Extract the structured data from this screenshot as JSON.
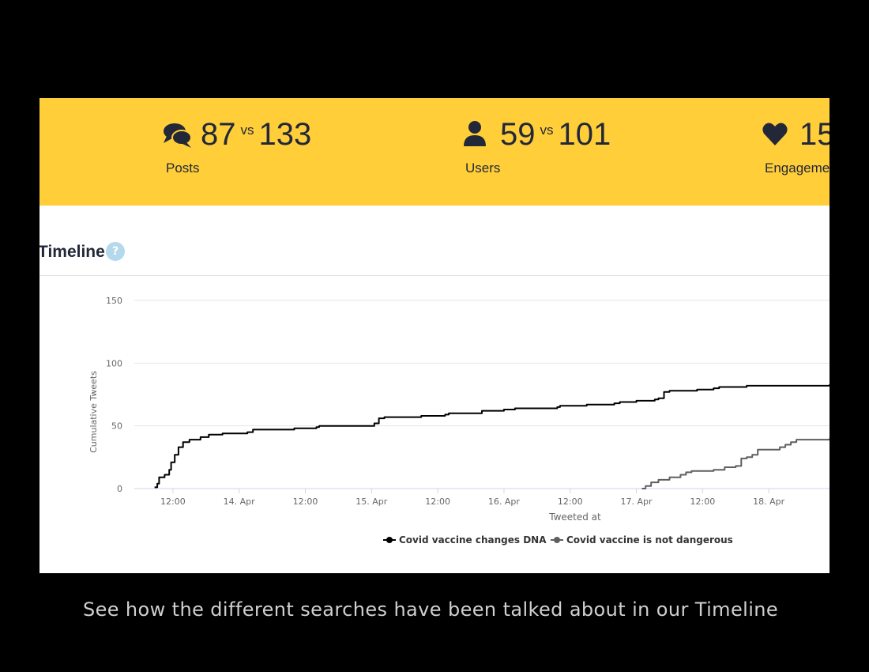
{
  "stats": [
    {
      "icon": "comments-icon",
      "value_a": "87",
      "vs": "vs",
      "value_b": "133",
      "label": "Posts"
    },
    {
      "icon": "user-icon",
      "value_a": "59",
      "vs": "vs",
      "value_b": "101",
      "label": "Users"
    },
    {
      "icon": "heart-icon",
      "value_a": "15",
      "label": "Engagement"
    }
  ],
  "timeline": {
    "title": "Timeline",
    "help": "?"
  },
  "caption": "See how the different searches have been talked about in our Timeline",
  "colors": {
    "stats_bar": "#ffce38",
    "series_a": "#000000",
    "series_b": "#5f5f5f",
    "help_icon": "#b5d9ec"
  },
  "chart_data": {
    "type": "line",
    "title": "",
    "xlabel": "Tweeted at",
    "ylabel": "Cumulative Tweets",
    "ylim": [
      0,
      150
    ],
    "yticks": [
      0,
      50,
      100,
      150
    ],
    "xlim": [
      "2021-04-13T05:00",
      "2021-04-18T11:00"
    ],
    "xticks": [
      {
        "t": "2021-04-13T12:00",
        "label": "12:00"
      },
      {
        "t": "2021-04-14T00:00",
        "label": "14. Apr"
      },
      {
        "t": "2021-04-14T12:00",
        "label": "12:00"
      },
      {
        "t": "2021-04-15T00:00",
        "label": "15. Apr"
      },
      {
        "t": "2021-04-15T12:00",
        "label": "12:00"
      },
      {
        "t": "2021-04-16T00:00",
        "label": "16. Apr"
      },
      {
        "t": "2021-04-16T12:00",
        "label": "12:00"
      },
      {
        "t": "2021-04-17T00:00",
        "label": "17. Apr"
      },
      {
        "t": "2021-04-17T12:00",
        "label": "12:00"
      },
      {
        "t": "2021-04-18T00:00",
        "label": "18. Apr"
      }
    ],
    "grid": true,
    "legend": "bottom-center",
    "series": [
      {
        "name": "Covid vaccine changes DNA",
        "color": "#000000",
        "points": [
          [
            "2021-04-13T08:40",
            1
          ],
          [
            "2021-04-13T09:10",
            4
          ],
          [
            "2021-04-13T09:30",
            9
          ],
          [
            "2021-04-13T10:30",
            11
          ],
          [
            "2021-04-13T11:20",
            15
          ],
          [
            "2021-04-13T11:40",
            21
          ],
          [
            "2021-04-13T12:20",
            27
          ],
          [
            "2021-04-13T13:00",
            33
          ],
          [
            "2021-04-13T13:50",
            37
          ],
          [
            "2021-04-13T15:00",
            39
          ],
          [
            "2021-04-13T17:00",
            41
          ],
          [
            "2021-04-13T18:30",
            43
          ],
          [
            "2021-04-13T21:00",
            44
          ],
          [
            "2021-04-14T01:30",
            45
          ],
          [
            "2021-04-14T02:30",
            47
          ],
          [
            "2021-04-14T10:00",
            48
          ],
          [
            "2021-04-14T14:00",
            49
          ],
          [
            "2021-04-14T14:30",
            50
          ],
          [
            "2021-04-15T00:30",
            52
          ],
          [
            "2021-04-15T01:20",
            56
          ],
          [
            "2021-04-15T02:20",
            57
          ],
          [
            "2021-04-15T09:00",
            58
          ],
          [
            "2021-04-15T13:20",
            59
          ],
          [
            "2021-04-15T14:00",
            60
          ],
          [
            "2021-04-15T20:00",
            62
          ],
          [
            "2021-04-16T00:00",
            63
          ],
          [
            "2021-04-16T02:00",
            64
          ],
          [
            "2021-04-16T09:40",
            65
          ],
          [
            "2021-04-16T10:10",
            66
          ],
          [
            "2021-04-16T15:00",
            67
          ],
          [
            "2021-04-16T20:00",
            68
          ],
          [
            "2021-04-16T21:00",
            69
          ],
          [
            "2021-04-17T00:00",
            70
          ],
          [
            "2021-04-17T03:20",
            71
          ],
          [
            "2021-04-17T04:00",
            72
          ],
          [
            "2021-04-17T05:00",
            77
          ],
          [
            "2021-04-17T06:00",
            78
          ],
          [
            "2021-04-17T11:00",
            79
          ],
          [
            "2021-04-17T14:00",
            80
          ],
          [
            "2021-04-17T15:00",
            81
          ],
          [
            "2021-04-17T20:00",
            82
          ],
          [
            "2021-04-18T05:00",
            82
          ],
          [
            "2021-04-18T11:00",
            83
          ]
        ]
      },
      {
        "name": "Covid vaccine is not dangerous",
        "color": "#5f5f5f",
        "points": [
          [
            "2021-04-17T01:00",
            0
          ],
          [
            "2021-04-17T01:40",
            2
          ],
          [
            "2021-04-17T02:40",
            5
          ],
          [
            "2021-04-17T04:00",
            7
          ],
          [
            "2021-04-17T06:00",
            9
          ],
          [
            "2021-04-17T08:00",
            11
          ],
          [
            "2021-04-17T09:00",
            13
          ],
          [
            "2021-04-17T10:00",
            14
          ],
          [
            "2021-04-17T14:00",
            15
          ],
          [
            "2021-04-17T16:00",
            17
          ],
          [
            "2021-04-17T18:00",
            18
          ],
          [
            "2021-04-17T19:00",
            24
          ],
          [
            "2021-04-17T20:00",
            25
          ],
          [
            "2021-04-17T21:00",
            27
          ],
          [
            "2021-04-17T22:00",
            31
          ],
          [
            "2021-04-18T02:00",
            33
          ],
          [
            "2021-04-18T03:00",
            35
          ],
          [
            "2021-04-18T04:00",
            37
          ],
          [
            "2021-04-18T05:00",
            39
          ],
          [
            "2021-04-18T11:00",
            40
          ]
        ]
      }
    ]
  }
}
